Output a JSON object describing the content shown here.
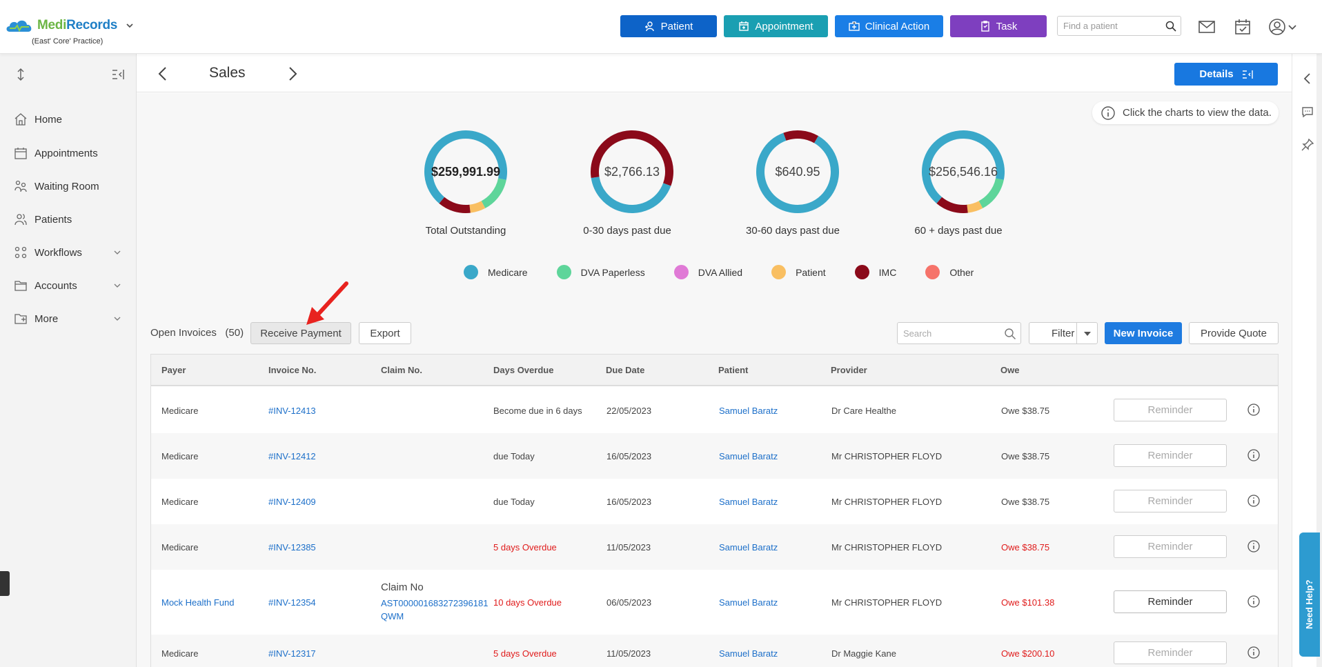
{
  "app": {
    "brand_medi": "Medi",
    "brand_records": "Records",
    "practice": "(East' Core' Practice)"
  },
  "topbar": {
    "patient_label": "Patient",
    "appointment_label": "Appointment",
    "clinical_action_label": "Clinical Action",
    "task_label": "Task",
    "find_placeholder": "Find a patient",
    "colors": {
      "patient": "#0d63c8",
      "appointment": "#1a9fb2",
      "clinical": "#1a7ee6",
      "task": "#7e3fbf"
    }
  },
  "sidebar": {
    "items": [
      {
        "label": "Home",
        "icon": "home-icon"
      },
      {
        "label": "Appointments",
        "icon": "calendar-icon"
      },
      {
        "label": "Waiting Room",
        "icon": "waiting-room-icon"
      },
      {
        "label": "Patients",
        "icon": "patients-icon"
      },
      {
        "label": "Workflows",
        "icon": "workflows-icon",
        "expandable": true
      },
      {
        "label": "Accounts",
        "icon": "folder-icon",
        "expandable": true
      },
      {
        "label": "More",
        "icon": "more-folder-icon",
        "expandable": true
      }
    ]
  },
  "header": {
    "title": "Sales",
    "details_label": "Details"
  },
  "hint": "Click the charts to view the data.",
  "summary": {
    "donuts": [
      {
        "value": "$259,991.99",
        "label": "Total Outstanding",
        "bold": true
      },
      {
        "value": "$2,766.13",
        "label": "0-30 days past due"
      },
      {
        "value": "$640.95",
        "label": "30-60 days past due"
      },
      {
        "value": "$256,546.16",
        "label": "60 + days past due"
      }
    ]
  },
  "legend": [
    {
      "label": "Medicare",
      "color": "#3aa8c9"
    },
    {
      "label": "DVA Paperless",
      "color": "#5ed59a"
    },
    {
      "label": "DVA Allied",
      "color": "#e07ad6"
    },
    {
      "label": "Patient",
      "color": "#f9bf62"
    },
    {
      "label": "IMC",
      "color": "#8b0a1a"
    },
    {
      "label": "Other",
      "color": "#f6736a"
    }
  ],
  "chart_data": {
    "type": "pie",
    "series_labels": [
      "Medicare",
      "DVA Paperless",
      "DVA Allied",
      "Patient",
      "IMC",
      "Other"
    ],
    "charts": [
      {
        "title": "Total Outstanding",
        "center": "$259,991.99",
        "shares": [
          0.67,
          0.14,
          0,
          0.06,
          0.13,
          0
        ]
      },
      {
        "title": "0-30 days past due",
        "center": "$2,766.13",
        "shares": [
          0.42,
          0,
          0,
          0,
          0.58,
          0
        ]
      },
      {
        "title": "30-60 days past due",
        "center": "$640.95",
        "shares": [
          0.86,
          0,
          0,
          0,
          0.14,
          0
        ]
      },
      {
        "title": "60 + days past due",
        "center": "$256,546.16",
        "shares": [
          0.67,
          0.14,
          0,
          0.06,
          0.13,
          0
        ]
      }
    ]
  },
  "toolbar": {
    "open_invoices": "Open Invoices",
    "open_count": "(50)",
    "receive_payment": "Receive Payment",
    "export": "Export",
    "search_placeholder": "Search",
    "filter": "Filter",
    "new_invoice": "New Invoice",
    "provide_quote": "Provide Quote"
  },
  "table": {
    "headers": [
      "Payer",
      "Invoice No.",
      "Claim No.",
      "Days Overdue",
      "Due Date",
      "Patient",
      "Provider",
      "Owe"
    ],
    "rows": [
      {
        "payer": "Medicare",
        "invoice": "#INV-12413",
        "claim_label": "",
        "claim_no": "",
        "overdue": "Become due in 6 days",
        "overdue_red": false,
        "due": "22/05/2023",
        "patient": "Samuel Baratz",
        "provider": "Dr Care Healthe",
        "owe": "Owe $38.75",
        "owe_red": false,
        "reminder": "Reminder",
        "reminder_active": false
      },
      {
        "payer": "Medicare",
        "invoice": "#INV-12412",
        "claim_label": "",
        "claim_no": "",
        "overdue": "due Today",
        "overdue_red": false,
        "due": "16/05/2023",
        "patient": "Samuel Baratz",
        "provider": "Mr CHRISTOPHER FLOYD",
        "owe": "Owe $38.75",
        "owe_red": false,
        "reminder": "Reminder",
        "reminder_active": false
      },
      {
        "payer": "Medicare",
        "invoice": "#INV-12409",
        "claim_label": "",
        "claim_no": "",
        "overdue": "due Today",
        "overdue_red": false,
        "due": "16/05/2023",
        "patient": "Samuel Baratz",
        "provider": "Mr CHRISTOPHER FLOYD",
        "owe": "Owe $38.75",
        "owe_red": false,
        "reminder": "Reminder",
        "reminder_active": false
      },
      {
        "payer": "Medicare",
        "invoice": "#INV-12385",
        "claim_label": "",
        "claim_no": "",
        "overdue": "5 days Overdue",
        "overdue_red": true,
        "due": "11/05/2023",
        "patient": "Samuel Baratz",
        "provider": "Mr CHRISTOPHER FLOYD",
        "owe": "Owe $38.75",
        "owe_red": true,
        "reminder": "Reminder",
        "reminder_active": false
      },
      {
        "payer": "Mock Health Fund",
        "invoice": "#INV-12354",
        "claim_label": "Claim No",
        "claim_no": "AST000001683272396181",
        "claim_no2": "QWM",
        "overdue": "10 days Overdue",
        "overdue_red": true,
        "due": "06/05/2023",
        "patient": "Samuel Baratz",
        "provider": "Mr CHRISTOPHER FLOYD",
        "owe": "Owe $101.38",
        "owe_red": true,
        "reminder": "Reminder",
        "reminder_active": true,
        "payer_link": true
      },
      {
        "payer": "Medicare",
        "invoice": "#INV-12317",
        "claim_label": "",
        "claim_no": "",
        "overdue": "5 days Overdue",
        "overdue_red": true,
        "due": "11/05/2023",
        "patient": "Samuel Baratz",
        "provider": "Dr Maggie Kane",
        "owe": "Owe $200.10",
        "owe_red": true,
        "reminder": "Reminder",
        "reminder_active": false
      }
    ]
  },
  "help": {
    "need_help": "Need Help?"
  },
  "annotation_color": "#e8231f"
}
